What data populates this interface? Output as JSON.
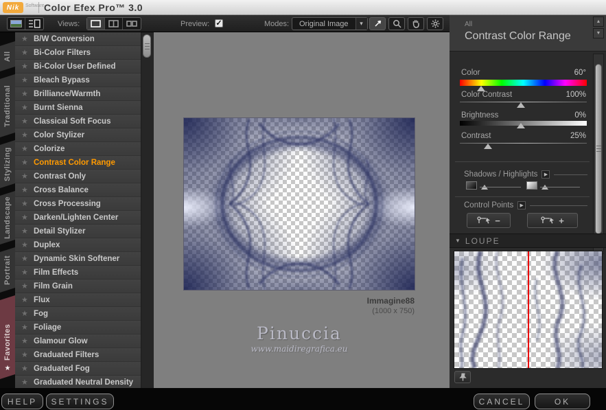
{
  "titlebar": {
    "logo": "Nik",
    "logo_sub": "Software",
    "title": "Color Efex Pro™ 3.0"
  },
  "toolbar": {
    "views_label": "Views:",
    "preview_label": "Preview:",
    "preview_check_glyph": "✓",
    "modes_label": "Modes:",
    "modes_value": "Original Image",
    "dropdown_arrow": "▾"
  },
  "tabs": {
    "items": [
      {
        "label": "All"
      },
      {
        "label": "Traditional"
      },
      {
        "label": "Stylizing"
      },
      {
        "label": "Landscape"
      },
      {
        "label": "Portrait"
      },
      {
        "label": "Favorites"
      }
    ],
    "favorites_star": "★"
  },
  "filters": {
    "star_glyph": "★",
    "items": [
      {
        "label": "B/W Conversion"
      },
      {
        "label": "Bi-Color Filters"
      },
      {
        "label": "Bi-Color User Defined"
      },
      {
        "label": "Bleach Bypass"
      },
      {
        "label": "Brilliance/Warmth"
      },
      {
        "label": "Burnt Sienna"
      },
      {
        "label": "Classical Soft Focus"
      },
      {
        "label": "Color Stylizer"
      },
      {
        "label": "Colorize"
      },
      {
        "label": "Contrast Color Range",
        "selected": true
      },
      {
        "label": "Contrast Only"
      },
      {
        "label": "Cross Balance"
      },
      {
        "label": "Cross Processing"
      },
      {
        "label": "Darken/Lighten Center"
      },
      {
        "label": "Detail Stylizer"
      },
      {
        "label": "Duplex"
      },
      {
        "label": "Dynamic Skin Softener"
      },
      {
        "label": "Film Effects"
      },
      {
        "label": "Film Grain"
      },
      {
        "label": "Flux"
      },
      {
        "label": "Fog"
      },
      {
        "label": "Foliage"
      },
      {
        "label": "Glamour Glow"
      },
      {
        "label": "Graduated Filters"
      },
      {
        "label": "Graduated Fog"
      },
      {
        "label": "Graduated Neutral Density"
      }
    ]
  },
  "preview": {
    "image_name": "Immagine88",
    "image_size": "(1000 x 750)",
    "watermark_title": "Pinuccia",
    "watermark_url": "www.maidiregrafica.eu"
  },
  "panel": {
    "category": "All",
    "filter_name": "Contrast Color Range",
    "sliders": [
      {
        "label": "Color",
        "value": "60°",
        "pos": 17
      },
      {
        "label": "Color Contrast",
        "value": "100%",
        "pos": 48
      },
      {
        "label": "Brightness",
        "value": "0%",
        "pos": 48
      },
      {
        "label": "Contrast",
        "value": "25%",
        "pos": 22
      }
    ],
    "shadows_highlights_label": "Shadows / Highlights",
    "control_points_label": "Control Points",
    "cp_minus": "−",
    "cp_plus": "+",
    "loupe_label": "LOUPE",
    "loupe_tri": "▼",
    "scroll_up": "▲",
    "scroll_down": "▼",
    "section_arrow": "▶"
  },
  "bottombar": {
    "help": "HELP",
    "settings": "SETTINGS",
    "cancel": "CANCEL",
    "ok": "OK"
  },
  "colors": {
    "accent": "#ff9a00",
    "favorites_tab": "#6d3a43",
    "loupe_line": "#e80000",
    "artwork_navy": "#1e2554"
  }
}
